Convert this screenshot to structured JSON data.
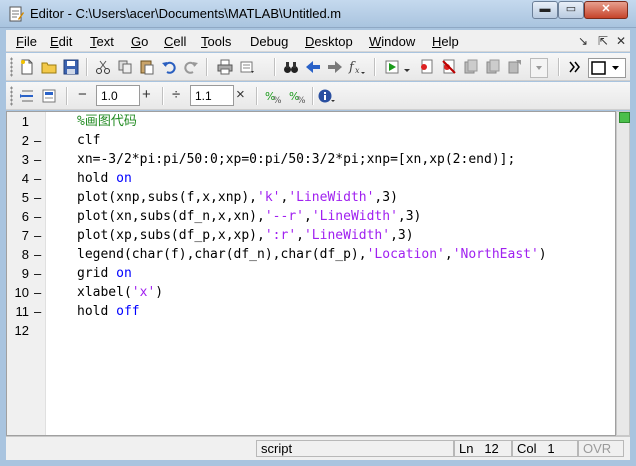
{
  "window": {
    "title": "Editor - C:\\Users\\acer\\Documents\\MATLAB\\Untitled.m",
    "min_glyph": "▬",
    "max_glyph": "▭",
    "close_glyph": "✕"
  },
  "menubar": {
    "items": [
      {
        "key": "F",
        "rest": "ile"
      },
      {
        "key": "E",
        "rest": "dit"
      },
      {
        "key": "T",
        "rest": "ext"
      },
      {
        "key": "G",
        "rest": "o"
      },
      {
        "key": "C",
        "rest": "ell"
      },
      {
        "key": "T",
        "rest": "ools",
        "prefix": ""
      },
      {
        "key": "g",
        "rest": "",
        "prefix": "Debu"
      },
      {
        "key": "D",
        "rest": "esktop"
      },
      {
        "key": "W",
        "rest": "indow"
      },
      {
        "key": "H",
        "rest": "elp"
      }
    ],
    "right_glyphs": [
      "↘",
      "⇱",
      "✕"
    ]
  },
  "toolbar2": {
    "minus": "−",
    "plus": "+",
    "divide": "÷",
    "times": "×",
    "value1": "1.0",
    "value2": "1.1"
  },
  "editor": {
    "lines": [
      {
        "num": "1",
        "dash": "",
        "tokens": [
          {
            "t": "%画图代码",
            "c": "cmt"
          }
        ]
      },
      {
        "num": "2",
        "dash": "–",
        "tokens": [
          {
            "t": "clf",
            "c": ""
          }
        ]
      },
      {
        "num": "3",
        "dash": "–",
        "tokens": [
          {
            "t": "xn=-3/2*pi:pi/50:0;xp=0:pi/50:3/2*pi;xnp=[xn,xp(2:end)];",
            "c": ""
          }
        ]
      },
      {
        "num": "4",
        "dash": "–",
        "tokens": [
          {
            "t": "hold ",
            "c": ""
          },
          {
            "t": "on",
            "c": "kw"
          }
        ]
      },
      {
        "num": "5",
        "dash": "–",
        "tokens": [
          {
            "t": "plot(xnp,subs(f,x,xnp),",
            "c": ""
          },
          {
            "t": "'k'",
            "c": "str"
          },
          {
            "t": ",",
            "c": ""
          },
          {
            "t": "'LineWidth'",
            "c": "str"
          },
          {
            "t": ",3)",
            "c": ""
          }
        ]
      },
      {
        "num": "6",
        "dash": "–",
        "tokens": [
          {
            "t": "plot(xn,subs(df_n,x,xn),",
            "c": ""
          },
          {
            "t": "'--r'",
            "c": "str"
          },
          {
            "t": ",",
            "c": ""
          },
          {
            "t": "'LineWidth'",
            "c": "str"
          },
          {
            "t": ",3)",
            "c": ""
          }
        ]
      },
      {
        "num": "7",
        "dash": "–",
        "tokens": [
          {
            "t": "plot(xp,subs(df_p,x,xp),",
            "c": ""
          },
          {
            "t": "':r'",
            "c": "str"
          },
          {
            "t": ",",
            "c": ""
          },
          {
            "t": "'LineWidth'",
            "c": "str"
          },
          {
            "t": ",3)",
            "c": ""
          }
        ]
      },
      {
        "num": "8",
        "dash": "–",
        "tokens": [
          {
            "t": "legend(char(f),char(df_n),char(df_p),",
            "c": ""
          },
          {
            "t": "'Location'",
            "c": "str"
          },
          {
            "t": ",",
            "c": ""
          },
          {
            "t": "'NorthEast'",
            "c": "str"
          },
          {
            "t": ")",
            "c": ""
          }
        ]
      },
      {
        "num": "9",
        "dash": "–",
        "tokens": [
          {
            "t": "grid ",
            "c": ""
          },
          {
            "t": "on",
            "c": "kw"
          }
        ]
      },
      {
        "num": "10",
        "dash": "–",
        "tokens": [
          {
            "t": "xlabel(",
            "c": ""
          },
          {
            "t": "'x'",
            "c": "str"
          },
          {
            "t": ")",
            "c": ""
          }
        ]
      },
      {
        "num": "11",
        "dash": "–",
        "tokens": [
          {
            "t": "hold ",
            "c": ""
          },
          {
            "t": "off",
            "c": "kw"
          }
        ]
      },
      {
        "num": "12",
        "dash": "",
        "tokens": []
      }
    ]
  },
  "statusbar": {
    "mode": "script",
    "ln_label": "Ln",
    "ln_value": "12",
    "col_label": "Col",
    "col_value": "1",
    "ovr": "OVR"
  }
}
